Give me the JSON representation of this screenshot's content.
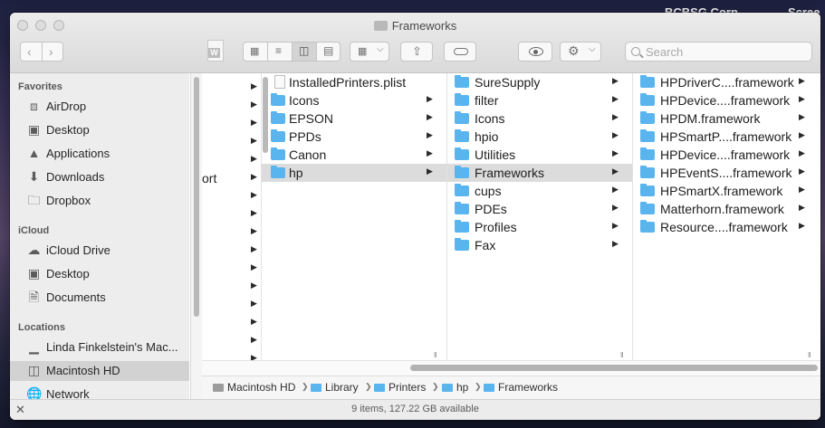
{
  "desktop": {
    "items": [
      "BCBSG Corp",
      "Scree"
    ]
  },
  "window": {
    "title": "Frameworks"
  },
  "toolbar": {
    "back_icon": "chevron-left-icon",
    "forward_icon": "chevron-right-icon",
    "view_modes": [
      "icon-view",
      "list-view",
      "column-view",
      "gallery-view"
    ],
    "selected_view": "column-view",
    "search_placeholder": "Search"
  },
  "sidebar": {
    "sections": [
      {
        "header": "Favorites",
        "items": [
          {
            "label": "AirDrop",
            "icon": "airdrop-icon"
          },
          {
            "label": "Desktop",
            "icon": "desktop-icon"
          },
          {
            "label": "Applications",
            "icon": "applications-icon"
          },
          {
            "label": "Downloads",
            "icon": "downloads-icon"
          },
          {
            "label": "Dropbox",
            "icon": "folder-icon"
          }
        ]
      },
      {
        "header": "iCloud",
        "items": [
          {
            "label": "iCloud Drive",
            "icon": "cloud-icon"
          },
          {
            "label": "Desktop",
            "icon": "desktop-icon"
          },
          {
            "label": "Documents",
            "icon": "documents-icon"
          }
        ]
      },
      {
        "header": "Locations",
        "items": [
          {
            "label": "Linda Finkelstein's Mac...",
            "icon": "laptop-icon"
          },
          {
            "label": "Macintosh HD",
            "icon": "disk-icon",
            "selected": true
          },
          {
            "label": "Network",
            "icon": "network-icon"
          }
        ]
      }
    ]
  },
  "columns": {
    "col0": {
      "visible_text": "ort"
    },
    "col1": {
      "items": [
        {
          "name": "InstalledPrinters.plist",
          "type": "file"
        },
        {
          "name": "Icons",
          "type": "folder"
        },
        {
          "name": "EPSON",
          "type": "folder"
        },
        {
          "name": "PPDs",
          "type": "folder"
        },
        {
          "name": "Canon",
          "type": "folder"
        },
        {
          "name": "hp",
          "type": "folder",
          "selected": true
        }
      ]
    },
    "col2": {
      "items": [
        {
          "name": "SureSupply",
          "type": "folder"
        },
        {
          "name": "filter",
          "type": "folder"
        },
        {
          "name": "Icons",
          "type": "folder"
        },
        {
          "name": "hpio",
          "type": "folder"
        },
        {
          "name": "Utilities",
          "type": "folder"
        },
        {
          "name": "Frameworks",
          "type": "folder",
          "selected": true
        },
        {
          "name": "cups",
          "type": "folder"
        },
        {
          "name": "PDEs",
          "type": "folder"
        },
        {
          "name": "Profiles",
          "type": "folder"
        },
        {
          "name": "Fax",
          "type": "folder"
        }
      ]
    },
    "col3": {
      "items": [
        {
          "name": "HPDriverC....framework",
          "type": "folder"
        },
        {
          "name": "HPDevice....framework",
          "type": "folder"
        },
        {
          "name": "HPDM.framework",
          "type": "folder"
        },
        {
          "name": "HPSmartP....framework",
          "type": "folder"
        },
        {
          "name": "HPDevice....framework",
          "type": "folder"
        },
        {
          "name": "HPEventS....framework",
          "type": "folder"
        },
        {
          "name": "HPSmartX.framework",
          "type": "folder"
        },
        {
          "name": "Matterhorn.framework",
          "type": "folder"
        },
        {
          "name": "Resource....framework",
          "type": "folder"
        }
      ]
    }
  },
  "pathbar": {
    "items": [
      "Macintosh HD",
      "Library",
      "Printers",
      "hp",
      "Frameworks"
    ]
  },
  "statusbar": {
    "text": "9 items, 127.22 GB available"
  },
  "colors": {
    "folder_blue": "#5ab4ee",
    "selection_gray": "#dcdcdc",
    "sidebar_bg": "#ededed"
  }
}
